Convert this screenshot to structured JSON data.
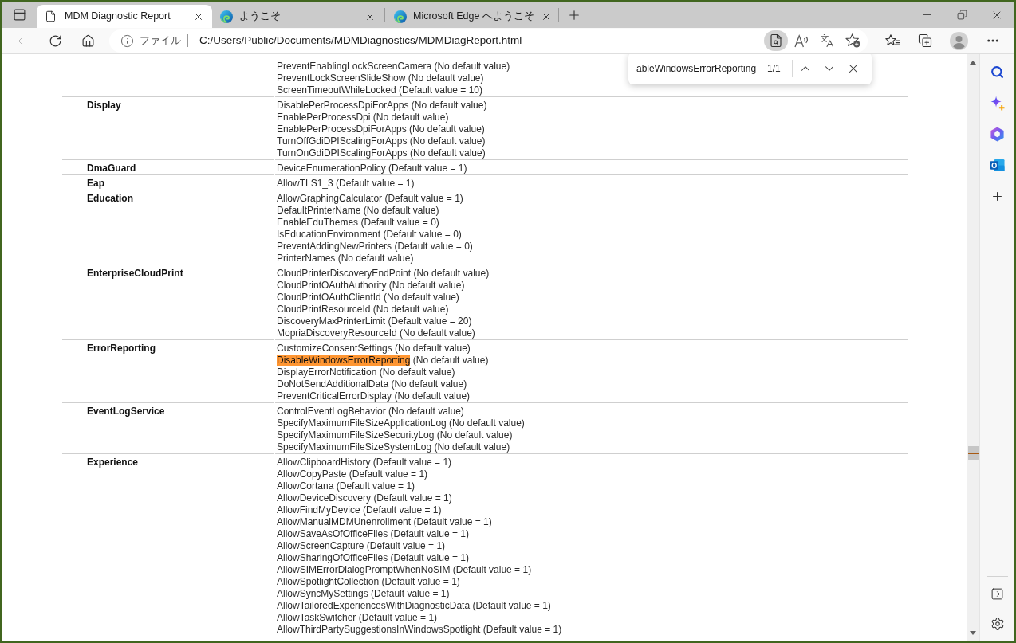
{
  "tabs": [
    {
      "title": "MDM Diagnostic Report",
      "kind": "page",
      "selected": true
    },
    {
      "title": "ようこそ",
      "kind": "edge",
      "selected": false
    },
    {
      "title": "Microsoft Edge へようこそ",
      "kind": "edge",
      "selected": false
    }
  ],
  "nav_buttons": [
    {
      "kind": "back",
      "disabled": true
    },
    {
      "kind": "refresh",
      "disabled": false
    },
    {
      "kind": "home",
      "disabled": false
    }
  ],
  "address_bar": {
    "scheme": "ファイル",
    "url": "C:/Users/Public/Documents/MDMDiagnostics/MDMDiagReport.html",
    "actions": [
      {
        "kind": "find",
        "active": true
      },
      {
        "kind": "read_aloud",
        "active": false
      },
      {
        "kind": "translate",
        "active": false
      },
      {
        "kind": "add_favorite",
        "active": false
      }
    ]
  },
  "find_bar": {
    "query": "ableWindowsErrorReporting",
    "count": "1/1"
  },
  "policy_table": {
    "rows": [
      {
        "settings": [
          {
            "name": "PreventEnablingLockScreenCamera",
            "note": "(No default value)",
            "highlighted": false
          },
          {
            "name": "PreventLockScreenSlideShow",
            "note": "(No default value)",
            "highlighted": false
          },
          {
            "name": "ScreenTimeoutWhileLocked",
            "note": "(Default value = 10)",
            "highlighted": false
          }
        ]
      },
      {
        "area": "Display",
        "settings": [
          {
            "name": "DisablePerProcessDpiForApps",
            "note": "(No default value)",
            "highlighted": false
          },
          {
            "name": "EnablePerProcessDpi",
            "note": "(No default value)",
            "highlighted": false
          },
          {
            "name": "EnablePerProcessDpiForApps",
            "note": "(No default value)",
            "highlighted": false
          },
          {
            "name": "TurnOffGdiDPIScalingForApps",
            "note": "(No default value)",
            "highlighted": false
          },
          {
            "name": "TurnOnGdiDPIScalingForApps",
            "note": "(No default value)",
            "highlighted": false
          }
        ]
      },
      {
        "area": "DmaGuard",
        "settings": [
          {
            "name": "DeviceEnumerationPolicy",
            "note": "(Default value = 1)",
            "highlighted": false
          }
        ]
      },
      {
        "area": "Eap",
        "settings": [
          {
            "name": "AllowTLS1_3",
            "note": "(Default value = 1)",
            "highlighted": false
          }
        ]
      },
      {
        "area": "Education",
        "settings": [
          {
            "name": "AllowGraphingCalculator",
            "note": "(Default value = 1)",
            "highlighted": false
          },
          {
            "name": "DefaultPrinterName",
            "note": "(No default value)",
            "highlighted": false
          },
          {
            "name": "EnableEduThemes",
            "note": "(Default value = 0)",
            "highlighted": false
          },
          {
            "name": "IsEducationEnvironment",
            "note": "(Default value = 0)",
            "highlighted": false
          },
          {
            "name": "PreventAddingNewPrinters",
            "note": "(Default value = 0)",
            "highlighted": false
          },
          {
            "name": "PrinterNames",
            "note": "(No default value)",
            "highlighted": false
          }
        ]
      },
      {
        "area": "EnterpriseCloudPrint",
        "settings": [
          {
            "name": "CloudPrinterDiscoveryEndPoint",
            "note": "(No default value)",
            "highlighted": false
          },
          {
            "name": "CloudPrintOAuthAuthority",
            "note": "(No default value)",
            "highlighted": false
          },
          {
            "name": "CloudPrintOAuthClientId",
            "note": "(No default value)",
            "highlighted": false
          },
          {
            "name": "CloudPrintResourceId",
            "note": "(No default value)",
            "highlighted": false
          },
          {
            "name": "DiscoveryMaxPrinterLimit",
            "note": "(Default value = 20)",
            "highlighted": false
          },
          {
            "name": "MopriaDiscoveryResourceId",
            "note": "(No default value)",
            "highlighted": false
          }
        ]
      },
      {
        "area": "ErrorReporting",
        "settings": [
          {
            "name": "CustomizeConsentSettings",
            "note": "(No default value)",
            "highlighted": false
          },
          {
            "name": "DisableWindowsErrorReporting",
            "note": "(No default value)",
            "highlighted": true
          },
          {
            "name": "DisplayErrorNotification",
            "note": "(No default value)",
            "highlighted": false
          },
          {
            "name": "DoNotSendAdditionalData",
            "note": "(No default value)",
            "highlighted": false
          },
          {
            "name": "PreventCriticalErrorDisplay",
            "note": "(No default value)",
            "highlighted": false
          }
        ]
      },
      {
        "area": "EventLogService",
        "settings": [
          {
            "name": "ControlEventLogBehavior",
            "note": "(No default value)",
            "highlighted": false
          },
          {
            "name": "SpecifyMaximumFileSizeApplicationLog",
            "note": "(No default value)",
            "highlighted": false
          },
          {
            "name": "SpecifyMaximumFileSizeSecurityLog",
            "note": "(No default value)",
            "highlighted": false
          },
          {
            "name": "SpecifyMaximumFileSizeSystemLog",
            "note": "(No default value)",
            "highlighted": false
          }
        ]
      },
      {
        "area": "Experience",
        "settings": [
          {
            "name": "AllowClipboardHistory",
            "note": "(Default value = 1)",
            "highlighted": false
          },
          {
            "name": "AllowCopyPaste",
            "note": "(Default value = 1)",
            "highlighted": false
          },
          {
            "name": "AllowCortana",
            "note": "(Default value = 1)",
            "highlighted": false
          },
          {
            "name": "AllowDeviceDiscovery",
            "note": "(Default value = 1)",
            "highlighted": false
          },
          {
            "name": "AllowFindMyDevice",
            "note": "(Default value = 1)",
            "highlighted": false
          },
          {
            "name": "AllowManualMDMUnenrollment",
            "note": "(Default value = 1)",
            "highlighted": false
          },
          {
            "name": "AllowSaveAsOfOfficeFiles",
            "note": "(Default value = 1)",
            "highlighted": false
          },
          {
            "name": "AllowScreenCapture",
            "note": "(Default value = 1)",
            "highlighted": false
          },
          {
            "name": "AllowSharingOfOfficeFiles",
            "note": "(Default value = 1)",
            "highlighted": false
          },
          {
            "name": "AllowSIMErrorDialogPromptWhenNoSIM",
            "note": "(Default value = 1)",
            "highlighted": false
          },
          {
            "name": "AllowSpotlightCollection",
            "note": "(Default value = 1)",
            "highlighted": false
          },
          {
            "name": "AllowSyncMySettings",
            "note": "(Default value = 1)",
            "highlighted": false
          },
          {
            "name": "AllowTailoredExperiencesWithDiagnosticData",
            "note": "(Default value = 1)",
            "highlighted": false
          },
          {
            "name": "AllowTaskSwitcher",
            "note": "(Default value = 1)",
            "highlighted": false
          },
          {
            "name": "AllowThirdPartySuggestionsInWindowsSpotlight",
            "note": "(Default value = 1)",
            "highlighted": false
          }
        ]
      }
    ]
  }
}
